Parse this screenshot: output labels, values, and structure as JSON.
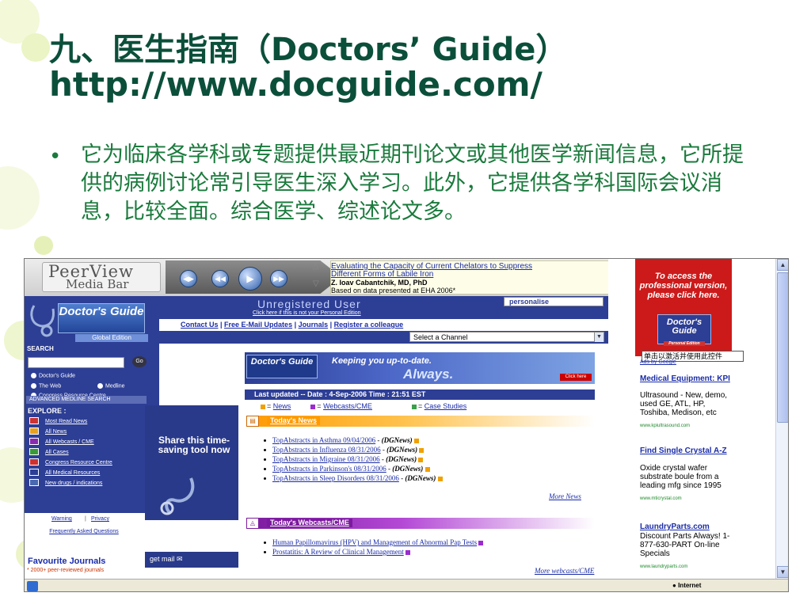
{
  "slide": {
    "title": "九、医生指南（Doctors’ Guide）",
    "url": "http://www.docguide.com/",
    "body": "它为临床各学科或专题提供最近期刊论文或其他医学新闻信息，它所提供的病例讨论常引导医生深入学习。此外，它提供各学科国际会议消息，比较全面。综合医学、综述论文多。"
  },
  "browser": {
    "mediabar": {
      "name": "PeerView",
      "sub": "Media Bar"
    },
    "ticker": {
      "line1": "Evaluating the Capacity of Current Chelators to Suppress",
      "line2": "Different Forms of Labile Iron",
      "author": "Z. Ioav Cabantchik, MD, PhD",
      "source": "Based on data presented at EHA 2006*"
    },
    "header": {
      "logo_text": "Doctor's Guide",
      "logo_edition": "Global Edition",
      "unreg": "Unregistered User",
      "unreg_sub": "Click here if this is not your Personal Edition",
      "personalise": "personalise"
    },
    "nav": [
      "Contact Us",
      "Free E-Mail Updates",
      "Journals",
      "Register a colleague"
    ],
    "channel_select": "Select a Channel",
    "left": {
      "search_label": "SEARCH",
      "go": "Go",
      "radios": [
        "Doctor's Guide",
        "The Web",
        "Medline",
        "Congress Resource Centre"
      ],
      "advanced": "ADVANCED MEDLINE SEARCH",
      "explore": "EXPLORE :",
      "explore_items": [
        "Most Read News",
        "All News",
        "All Webcasts / CME",
        "All Cases",
        "Congress Resource Centre",
        "All Medical Resources",
        "New drugs / indications"
      ],
      "warning": "Warning",
      "privacy": "Privacy",
      "faq": "Frequently Asked Questions",
      "fav_title": "Favourite Journals",
      "fav_sub": "* 2000+ peer-reviewed journals"
    },
    "share": "Share this time-saving tool now",
    "getmail": "get mail",
    "banner": {
      "logo": "Doctor's Guide",
      "line1": "Keeping you up-to-date.",
      "line2": "Always.",
      "click": "Click here"
    },
    "last_updated": "Last updated  --  Date : 4-Sep-2006    Time : 21:51 EST",
    "legend": [
      "News",
      "Webcasts/CME",
      "Case Studies"
    ],
    "news_title": "Today's News",
    "news": [
      {
        "link": "TopAbstracts in Asthma 09/04/2006",
        "src": "(DGNews)"
      },
      {
        "link": "TopAbstracts in Influenza 08/31/2006",
        "src": "(DGNews)"
      },
      {
        "link": "TopAbstracts in Migraine 08/31/2006",
        "src": "(DGNews)"
      },
      {
        "link": "TopAbstracts in Parkinson's 08/31/2006",
        "src": "(DGNews)"
      },
      {
        "link": "TopAbstracts in Sleep Disorders 08/31/2006",
        "src": "(DGNews)"
      }
    ],
    "more_news": "More News",
    "webcast_title": "Today's Webcasts/CME",
    "webcasts": [
      "Human Papillomavirus (HPV) and Management of Abnormal Pap Tests",
      "Prostatitis: A Review of Clinical Management"
    ],
    "more_webcasts": "More webcasts/CME",
    "right": {
      "red_ad": "To access the professional version, please click here.",
      "red_logo": "Doctor's Guide",
      "red_edition": "Personal Edition",
      "tooltip": "单击以激活并使用此控件",
      "adsby": "Ads by Google",
      "ads": [
        {
          "title": "Medical Equipment: KPI",
          "body": "Ultrasound - New, demo, used GE, ATL, HP, Toshiba, Medison, etc",
          "url": "www.kpiultrasound.com"
        },
        {
          "title": "Find Single Crystal A-Z",
          "body": "Oxide crystal wafer substrate boule from a leading mfg since 1995",
          "url": "www.mticrystal.com"
        },
        {
          "title": "LaundryParts.com",
          "body": "Discount Parts Always! 1-877-630-PART On-line Specials",
          "url": "www.laundryparts.com"
        }
      ]
    },
    "status": "Internet"
  }
}
